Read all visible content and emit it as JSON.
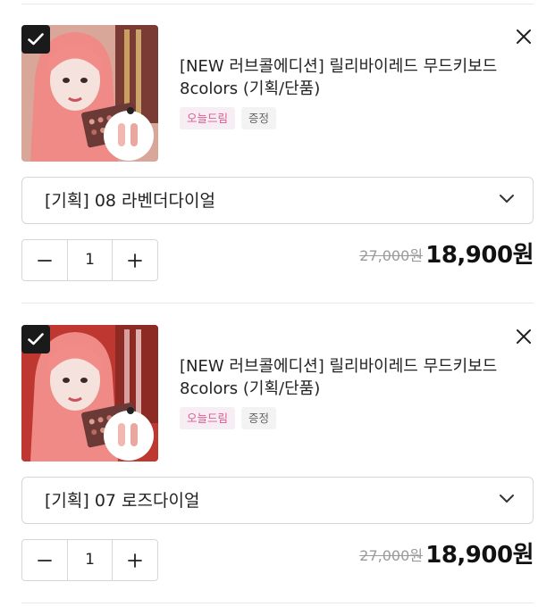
{
  "cart_items": [
    {
      "selected": true,
      "title": "[NEW 러브콜에디션] 릴리바이레드 무드키보드 8colors (기획/단품)",
      "tags": [
        "오늘드림",
        "증정"
      ],
      "option": "[기획] 08 라벤더다이얼",
      "quantity": "1",
      "original_price": "27,000원",
      "sale_price": "18,900원"
    },
    {
      "selected": true,
      "title": "[NEW 러브콜에디션] 릴리바이레드 무드키보드 8colors (기획/단품)",
      "tags": [
        "오늘드림",
        "증정"
      ],
      "option": "[기획] 07 로즈다이얼",
      "quantity": "1",
      "original_price": "27,000원",
      "sale_price": "18,900원"
    }
  ],
  "icons": {
    "checkbox": "check-icon",
    "remove": "close-icon",
    "option_dropdown": "chevron-down-icon",
    "decrease": "minus-icon",
    "increase": "plus-icon"
  },
  "colors": {
    "checkbox_bg": "#1a1a1a",
    "tag_pink_text": "#e05a91",
    "tag_pink_bg": "#f7eef3",
    "tag_gray_bg": "#f3f3f3",
    "border": "#d6d6d6",
    "original_price": "#9a9a9a"
  }
}
